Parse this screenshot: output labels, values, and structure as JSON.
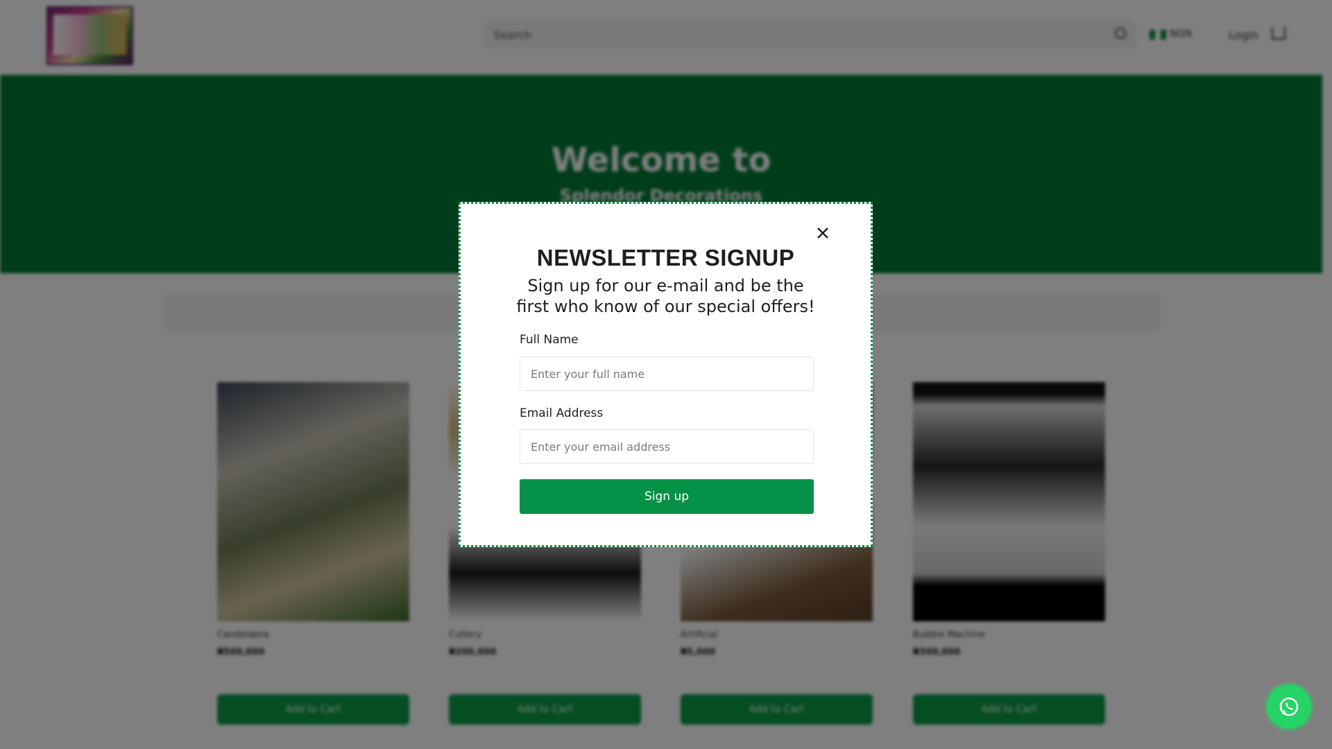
{
  "header": {
    "search_placeholder": "Search",
    "currency": "NGN",
    "login_label": "Login"
  },
  "hero": {
    "title": "Welcome to",
    "subtitle": "Splendor Decorations"
  },
  "products": [
    {
      "name": "Candelabra",
      "price": "₦500,000",
      "button": "Add to Cart"
    },
    {
      "name": "Cutlery",
      "price": "₦200,000",
      "button": "Add to Cart"
    },
    {
      "name": "Artificial",
      "price": "₦5,000",
      "button": "Add to Cart"
    },
    {
      "name": "Bubble Machine",
      "price": "₦300,000",
      "button": "Add to Cart"
    }
  ],
  "modal": {
    "title": "NEWSLETTER SIGNUP",
    "subtitle": "Sign up for our e-mail and be the first who know of our special offers!",
    "name_label": "Full Name",
    "name_placeholder": "Enter your full name",
    "email_label": "Email Address",
    "email_placeholder": "Enter your email address",
    "button_label": "Sign up"
  },
  "colors": {
    "accent": "#059146",
    "hero": "#007a35",
    "whatsapp": "#25d366"
  }
}
